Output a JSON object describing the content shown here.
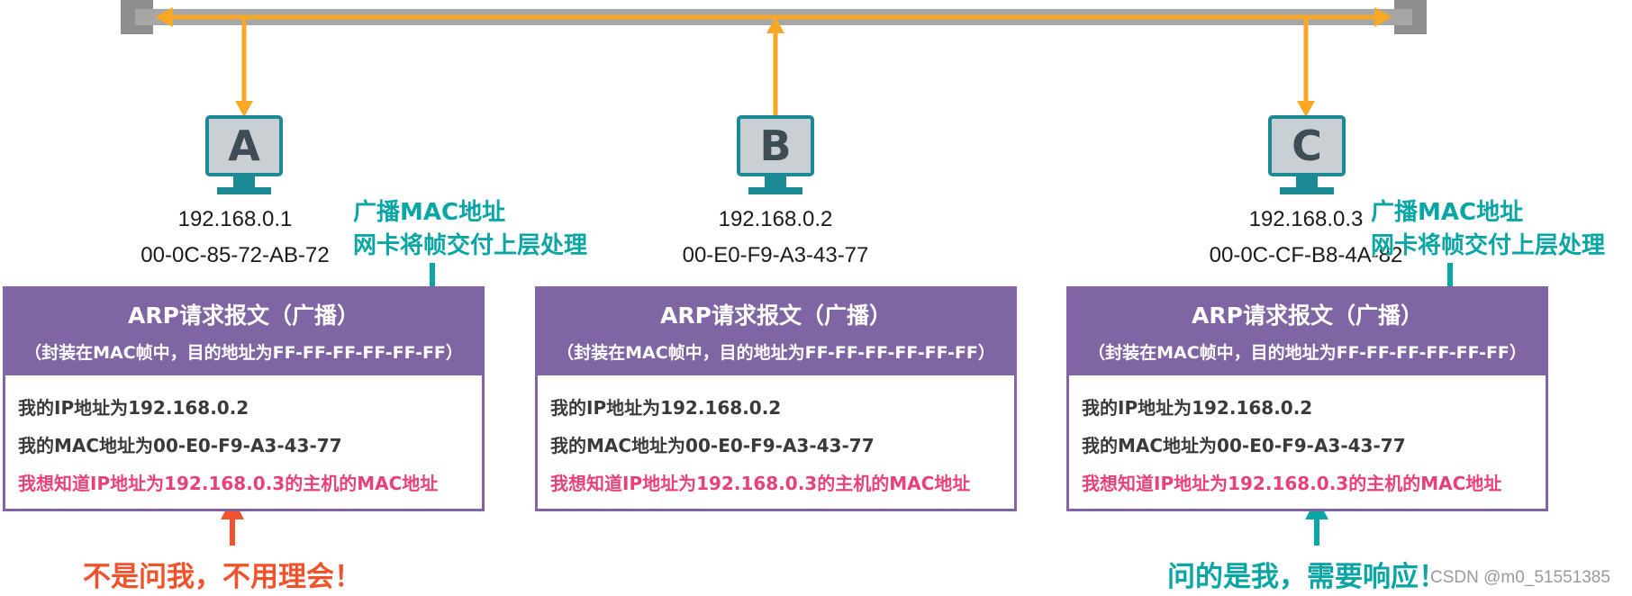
{
  "colors": {
    "bus": "#a6a6a6",
    "signal": "#f9a825",
    "teal": "#0aa6a6",
    "purple": "#8065a5",
    "query_pink": "#e8417a",
    "ignore_red": "#f0532b"
  },
  "hosts": [
    {
      "letter": "A",
      "ip": "192.168.0.1",
      "mac": "00-0C-85-72-AB-72"
    },
    {
      "letter": "B",
      "ip": "192.168.0.2",
      "mac": "00-E0-F9-A3-43-77"
    },
    {
      "letter": "C",
      "ip": "192.168.0.3",
      "mac": "00-0C-CF-B8-4A-82"
    }
  ],
  "broadcast_note": {
    "line1": "广播MAC地址",
    "line2": "网卡将帧交付上层处理"
  },
  "arp_box": {
    "title": "ARP请求报文（广播）",
    "subtitle": "（封装在MAC帧中，目的地址为FF-FF-FF-FF-FF-FF）",
    "my_ip": "我的IP地址为192.168.0.2",
    "my_mac": "我的MAC地址为00-E0-F9-A3-43-77",
    "query": "我想知道IP地址为192.168.0.3的主机的MAC地址"
  },
  "callouts": {
    "a": "不是问我，不用理会！",
    "c": "问的是我，需要响应！"
  },
  "watermark": "CSDN @m0_51551385"
}
